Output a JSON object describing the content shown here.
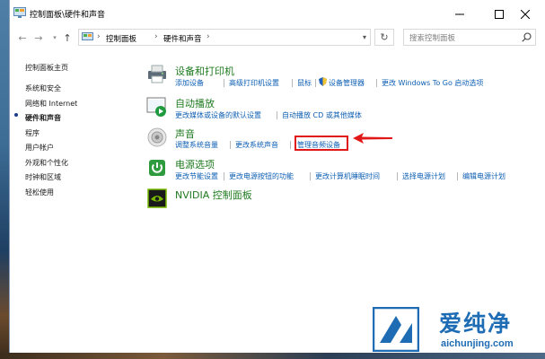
{
  "window": {
    "title": "控制面板\\硬件和声音"
  },
  "address": {
    "crumbs": [
      "控制面板",
      "硬件和声音"
    ],
    "search_placeholder": "搜索控制面板"
  },
  "leftnav": {
    "items": [
      "控制面板主页",
      "系统和安全",
      "网络和 Internet",
      "硬件和声音",
      "程序",
      "用户帐户",
      "外观和个性化",
      "时钟和区域",
      "轻松使用"
    ],
    "current_index": 3
  },
  "categories": [
    {
      "title": "设备和打印机",
      "icon": "printer-icon",
      "links": [
        "添加设备",
        "高级打印机设置",
        "鼠标",
        "设备管理器",
        "更改 Windows To Go 启动选项"
      ]
    },
    {
      "title": "自动播放",
      "icon": "autoplay-icon",
      "links": [
        "更改媒体或设备的默认设置",
        "自动播放 CD 或其他媒体"
      ]
    },
    {
      "title": "声音",
      "icon": "speaker-icon",
      "links": [
        "调整系统音量",
        "更改系统声音",
        "管理音频设备"
      ]
    },
    {
      "title": "电源选项",
      "icon": "power-icon",
      "links": [
        "更改节能设置",
        "更改电源按钮的功能",
        "更改计算机睡眠时间",
        "选择电源计划",
        "编辑电源计划"
      ]
    },
    {
      "title": "NVIDIA 控制面板",
      "icon": "nvidia-icon",
      "links": []
    }
  ],
  "watermark": {
    "brand": "爱纯净",
    "url": "aichunjing.com"
  },
  "colors": {
    "link": "#0e5fb3",
    "category_title": "#1f7a1f",
    "highlight": "#e01818",
    "watermark": "#1e6cb3"
  }
}
